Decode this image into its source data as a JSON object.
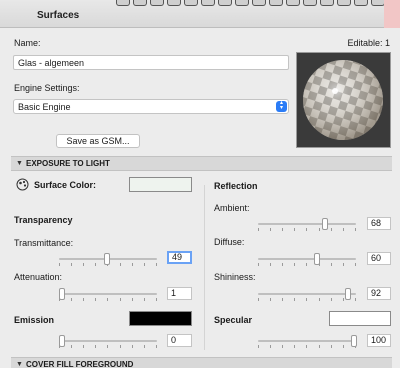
{
  "window": {
    "title": "Surfaces"
  },
  "name_field": {
    "label": "Name:",
    "value": "Glas - algemeen",
    "editable_text": "Editable: 1"
  },
  "engine": {
    "label": "Engine Settings:",
    "selected": "Basic Engine"
  },
  "save_gsm_label": "Save as GSM...",
  "sections": {
    "exposure": "EXPOSURE TO LIGHT",
    "cover_fill": "COVER FILL FOREGROUND"
  },
  "left": {
    "surface_color_label": "Surface Color:",
    "surface_color": "#eef3ee",
    "transparency_heading": "Transparency",
    "transmittance": {
      "label": "Transmittance:",
      "value": "49",
      "min": 0,
      "max": 100
    },
    "attenuation": {
      "label": "Attenuation:",
      "value": "1",
      "min": 0,
      "max": 100
    },
    "emission_label": "Emission",
    "emission_color": "#000000",
    "emission": {
      "value": "0",
      "min": 0,
      "max": 100
    }
  },
  "right": {
    "reflection_heading": "Reflection",
    "ambient": {
      "label": "Ambient:",
      "value": "68",
      "min": 0,
      "max": 100
    },
    "diffuse": {
      "label": "Diffuse:",
      "value": "60",
      "min": 0,
      "max": 100
    },
    "shininess": {
      "label": "Shininess:",
      "value": "92",
      "min": 0,
      "max": 100
    },
    "specular_label": "Specular",
    "specular_color": "#ffffff",
    "specular": {
      "value": "100",
      "min": 0,
      "max": 100
    }
  },
  "icons": {
    "surface_color_icon": "palette-icon",
    "collapse": "triangle-down-icon"
  }
}
